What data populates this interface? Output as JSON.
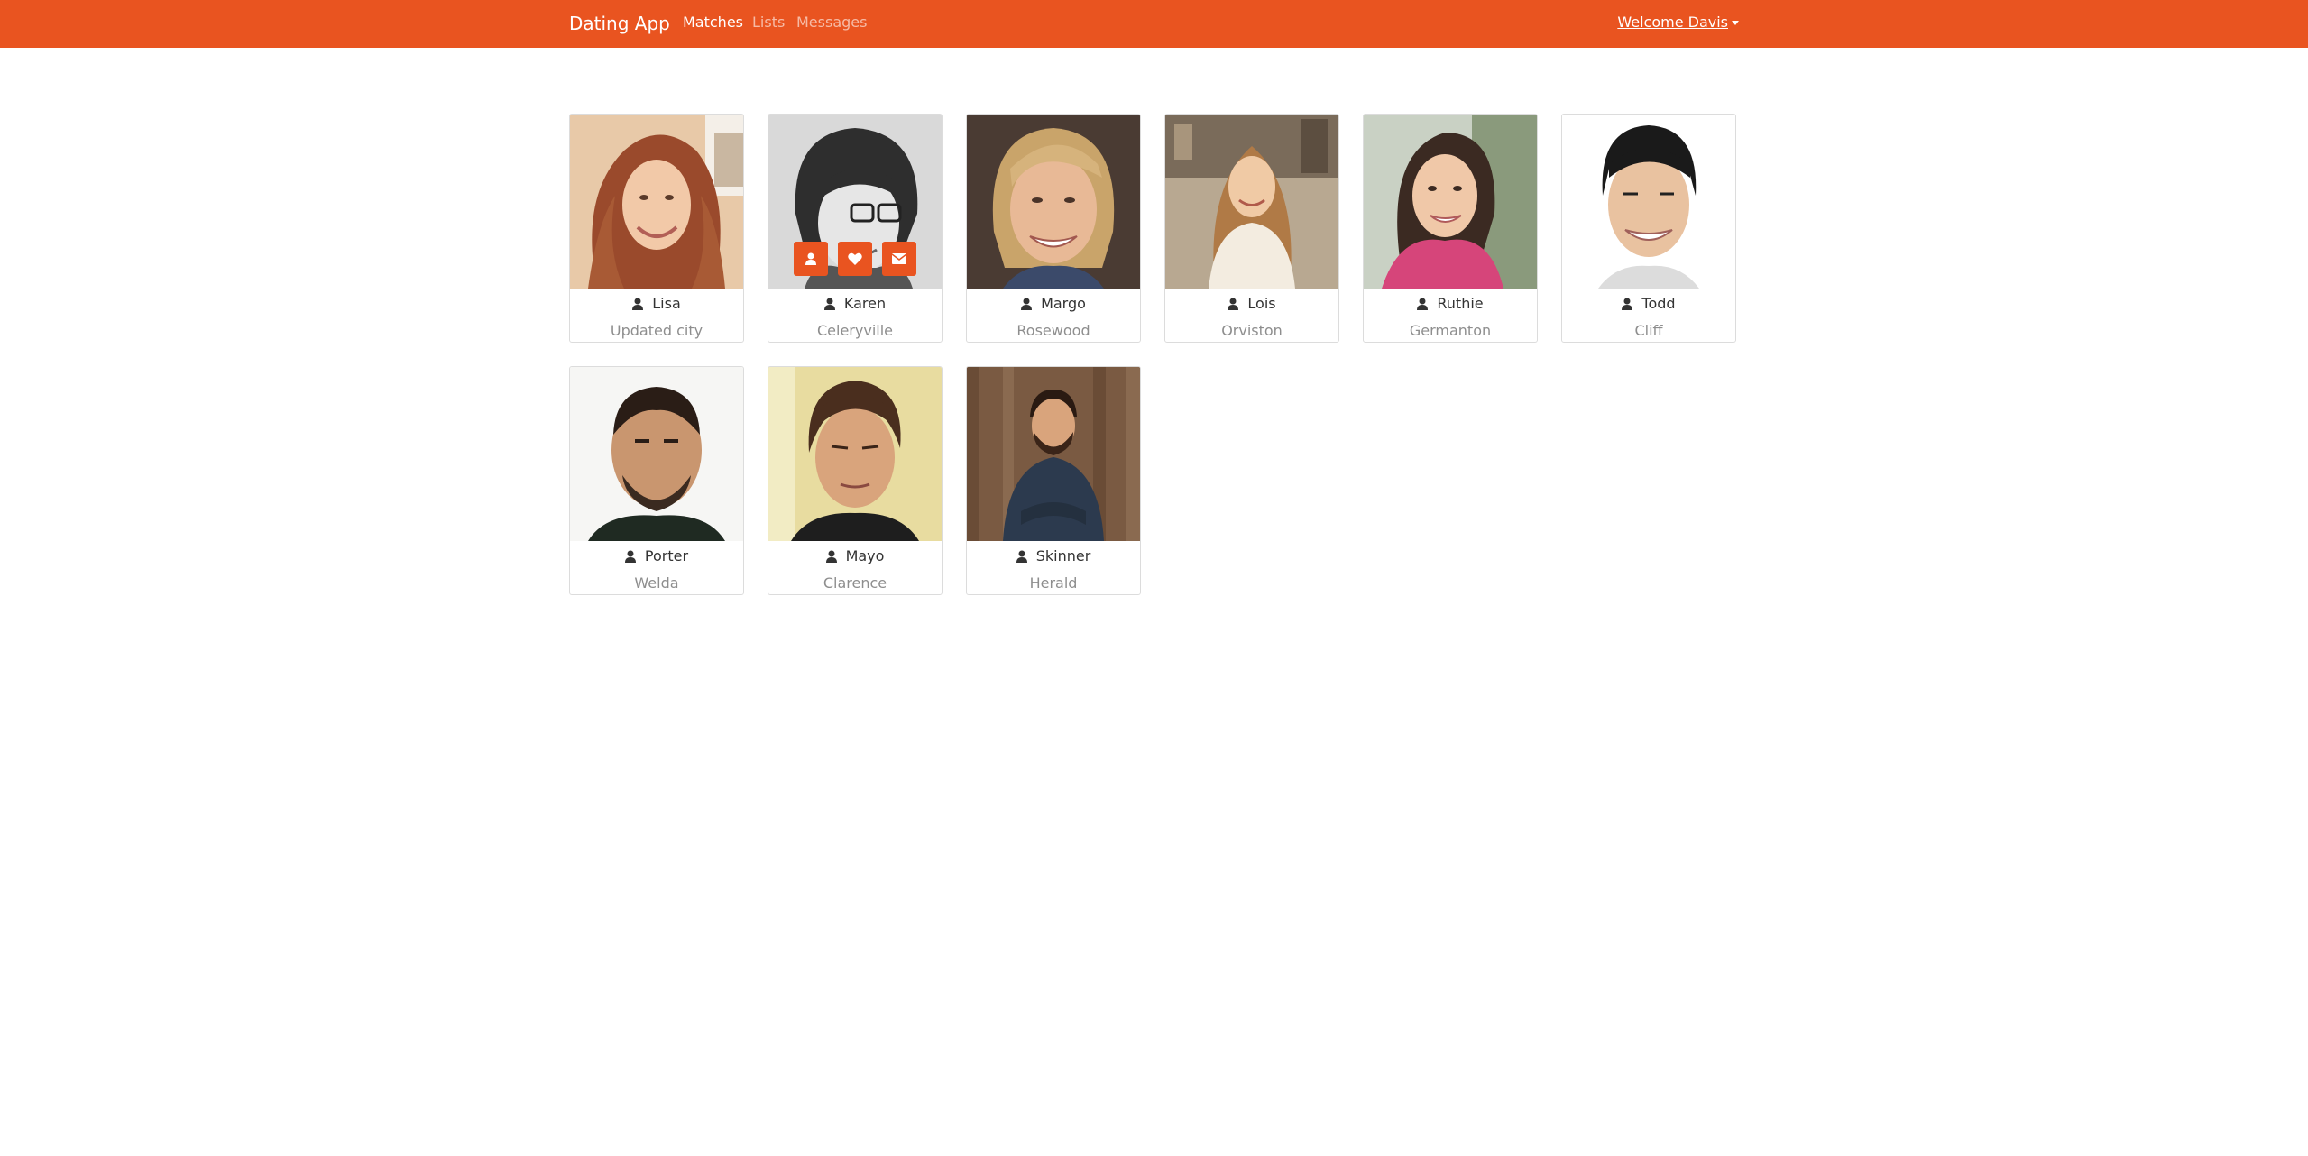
{
  "navbar": {
    "brand": "Dating App",
    "links": [
      "Matches",
      "Lists",
      "Messages"
    ],
    "welcome": "Welcome Davis",
    "color": "#e95420"
  },
  "members": [
    {
      "name": "Lisa",
      "city": "Updated city"
    },
    {
      "name": "Karen",
      "city": "Celeryville"
    },
    {
      "name": "Margo",
      "city": "Rosewood"
    },
    {
      "name": "Lois",
      "city": "Orviston"
    },
    {
      "name": "Ruthie",
      "city": "Germanton"
    },
    {
      "name": "Todd",
      "city": "Cliff"
    },
    {
      "name": "Porter",
      "city": "Welda"
    },
    {
      "name": "Mayo",
      "city": "Clarence"
    },
    {
      "name": "Skinner",
      "city": "Herald"
    }
  ],
  "icons": {
    "name_icon": "user-icon",
    "hover_buttons": [
      "user-icon",
      "heart-icon",
      "envelope-icon"
    ]
  }
}
